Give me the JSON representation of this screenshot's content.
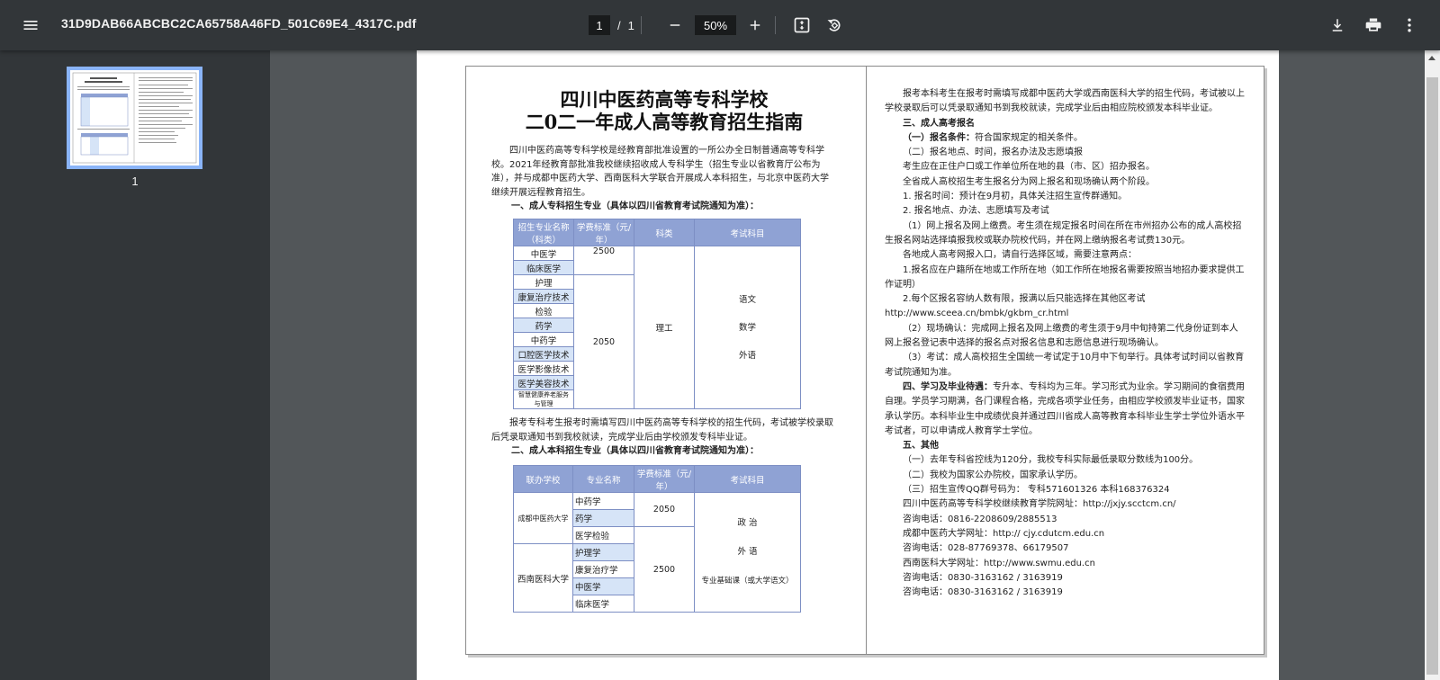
{
  "toolbar": {
    "filename": "31D9DAB66ABCBC2CA65758A46FD_501C69E4_4317C.pdf",
    "current_page": "1",
    "slash": "/",
    "total_pages": "1",
    "zoom": "50%"
  },
  "sidebar": {
    "thumb_label": "1"
  },
  "document": {
    "title_line1": "四川中医药高等专科学校",
    "title_line2": "二0二一年成人高等教育招生指南",
    "intro": "四川中医药高等专科学校是经教育部批准设置的一所公办全日制普通高等专科学校。2021年经教育部批准我校继续招收成人专科学生（招生专业以省教育厅公布为准），并与成都中医药大学、西南医科大学联合开展成人本科招生，与北京中医药大学继续开展远程教育招生。",
    "heading1": "一、成人专科招生专业（具体以四川省教育考试院通知为准）：",
    "table1": {
      "headers": [
        "招生专业名称（科类）",
        "学费标准（元/年）",
        "科类",
        "考试科目"
      ],
      "majors": [
        "中医学",
        "临床医学",
        "护理",
        "康复治疗技术",
        "检验",
        "药学",
        "中药学",
        "口腔医学技术",
        "医学影像技术",
        "医学美容技术",
        "智慧健康养老服务与管理"
      ],
      "fee_a": "2500",
      "fee_b": "2050",
      "category": "理工",
      "subjects": [
        "语文",
        "数学",
        "外语"
      ]
    },
    "para2": "报考专科考生报考时需填写四川中医药高等专科学校的招生代码，考试被学校录取后凭录取通知书到我校就读，完成学业后由学校颁发专科毕业证。",
    "heading2": "二、成人本科招生专业（具体以四川省教育考试院通知为准）：",
    "table2": {
      "headers": [
        "联办学校",
        "专业名称",
        "学费标准（元/年）",
        "考试科目"
      ],
      "school_a": "成都中医药大学",
      "school_b": "西南医科大学",
      "majors": [
        "中药学",
        "药学",
        "医学检验",
        "护理学",
        "康复治疗学",
        "中医学",
        "临床医学"
      ],
      "fee_a": "2050",
      "fee_b": "2500",
      "subjects": [
        "政 治",
        "外 语",
        "专业基础课（或大学语文）"
      ]
    },
    "right": {
      "p1": "报考本科考生在报考时需填写成都中医药大学或西南医科大学的招生代码，考试被以上学校录取后可以凭录取通知书到我校就读，完成学业后由相应院校颁发本科毕业证。",
      "h3": "三、成人高考报名",
      "l1a": "（一）报名条件：",
      "l1b": "符合国家规定的相关条件。",
      "l2": "（二）报名地点、时间，报名办法及志愿填报",
      "l3": "考生应在正住户口或工作单位所在地的县（市、区）招办报名。",
      "l4": "全省成人高校招生考生报名分为网上报名和现场确认两个阶段。",
      "l5": "1. 报名时间：预计在9月初，具体关注招生宣传群通知。",
      "l6": "2. 报名地点、办法、志愿填写及考试",
      "l7": "（1）网上报名及网上缴费。考生须在规定报名时间在所在市州招办公布的成人高校招生报名网站选择填报我校或联办院校代码，并在网上缴纳报名考试费130元。",
      "l8": "各地成人高考网报入口，请自行选择区域，需要注意两点：",
      "l9": "1.报名应在户籍所在地或工作所在地（如工作所在地报名需要按照当地招办要求提供工作证明）",
      "l10": "2.每个区报名容纳人数有限，报满以后只能选择在其他区考试",
      "l11": "http://www.sceea.cn/bmbk/gkbm_cr.html",
      "l12": "（2）现场确认：完成网上报名及网上缴费的考生须于9月中旬持第二代身份证到本人网上报名登记表中选择的报名点对报名信息和志愿信息进行现场确认。",
      "l13": "（3）考试：成人高校招生全国统一考试定于10月中下旬举行。具体考试时间以省教育考试院通知为准。",
      "l14a": "四、学习及毕业待遇：",
      "l14b": "专升本、专科均为三年。学习形式为业余。学习期间的食宿费用自理。学员学习期满，各门课程合格，完成各项学业任务，由相应学校颁发毕业证书，国家承认学历。本科毕业生中成绩优良并通过四川省成人高等教育本科毕业生学士学位外语水平考试者，可以申请成人教育学士学位。",
      "h5": "五、其他",
      "l15": "（一）去年专科省控线为120分，我校专科实际最低录取分数线为100分。",
      "l16": "（二）我校为国家公办院校，国家承认学历。",
      "l17": "（三）招生宣传QQ群号码为：  专科571601326    本科168376324",
      "l18": "四川中医药高等专科学校继续教育学院网址：http://jxjy.scctcm.cn/",
      "l19": "咨询电话：0816-2208609/2885513",
      "l20": "成都中医药大学网址：http:// cjy.cdutcm.edu.cn",
      "l21": "咨询电话：028-87769378、66179507",
      "l22": "西南医科大学网址：http://www.swmu.edu.cn",
      "l23": "咨询电话：0830-3163162 / 3163919",
      "l24": "咨询电话：0830-3163162 / 3163919"
    }
  },
  "colors": {
    "toolbar": "#323639",
    "background": "#525659",
    "accent": "#8ab4f8",
    "table_header": "#8fa2d4"
  },
  "icons": [
    "menu-icon",
    "zoom-out-icon",
    "zoom-in-icon",
    "fit-page-icon",
    "rotate-icon",
    "download-icon",
    "print-icon",
    "more-vert-icon"
  ]
}
